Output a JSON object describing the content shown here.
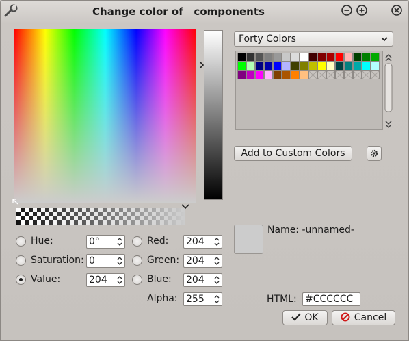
{
  "window": {
    "title": "Change color of   components",
    "app_icon": "wrench-icon",
    "minimize_icon": "minimize-icon",
    "maximize_icon": "maximize-icon",
    "close_icon": "close-icon"
  },
  "palette": {
    "selected": "Forty Colors",
    "colors": [
      "#000000",
      "#333333",
      "#555555",
      "#808080",
      "#999999",
      "#c8c8c8",
      "#dcdcdc",
      "#ffffff",
      "#400000",
      "#800000",
      "#aa0000",
      "#ff0000",
      "#ffb4b4",
      "#004000",
      "#008000",
      "#00aa00",
      "#00ff00",
      "#b4ffb4",
      "#000080",
      "#0000aa",
      "#0000ff",
      "#b4b4ff",
      "#404000",
      "#808000",
      "#c0c000",
      "#ffff00",
      "#ffffc0",
      "#004040",
      "#008080",
      "#00aaaa",
      "#00ffff",
      "#b4ffff",
      "#800080",
      "#c000c0",
      "#ff00ff",
      "#ffb4ff",
      "#804000",
      "#aa5500",
      "#ff8000",
      "#ffc080",
      "",
      "",
      "",
      "",
      "",
      "",
      "",
      ""
    ]
  },
  "buttons": {
    "add_custom": "Add to Custom Colors",
    "settings_icon": "gear-icon",
    "ok": "OK",
    "ok_icon": "checkmark-icon",
    "cancel": "Cancel",
    "cancel_icon": "cancel-icon"
  },
  "fields": {
    "hue_label": "Hue:",
    "hue_value": "0°",
    "saturation_label": "Saturation:",
    "saturation_value": "0",
    "value_label": "Value:",
    "value_value": "204",
    "red_label": "Red:",
    "red_value": "204",
    "green_label": "Green:",
    "green_value": "204",
    "blue_label": "Blue:",
    "blue_value": "204",
    "alpha_label": "Alpha:",
    "alpha_value": "255",
    "html_label": "HTML:",
    "html_value": "#CCCCCC"
  },
  "name": {
    "label": "Name: -unnamed-"
  },
  "selected_color": "#cccccc",
  "selected_mode": "Value"
}
